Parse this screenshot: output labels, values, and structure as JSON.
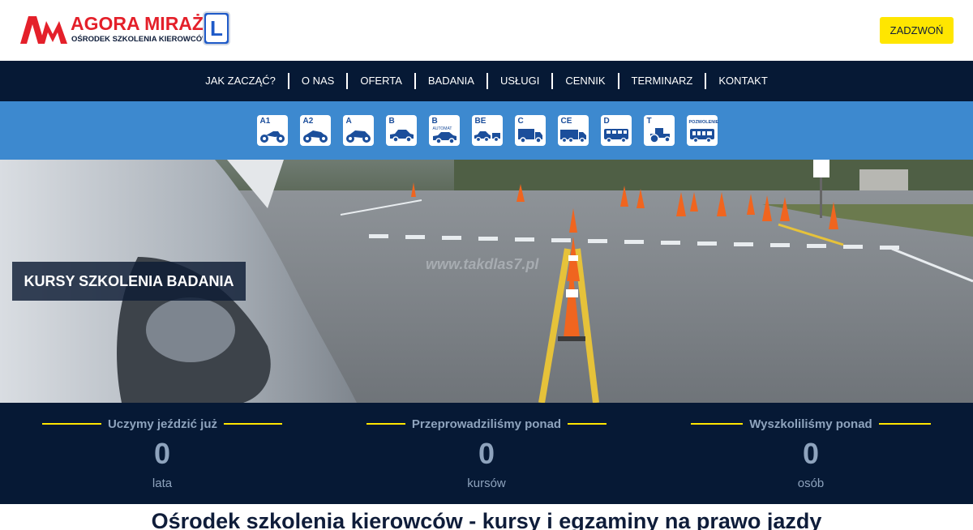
{
  "brand": {
    "title": "AGORA MIRAŻ",
    "subtitle": "OŚRODEK SZKOLENIA KIEROWCÓW",
    "badge_letter": "L",
    "accent_red": "#e4202a",
    "navy": "#061935",
    "blue": "#3d89cf",
    "yellow": "#ffe600"
  },
  "header": {
    "call_label": "ZADZWOŃ"
  },
  "nav": {
    "items": [
      {
        "label": "JAK ZACZĄĆ?"
      },
      {
        "label": "O NAS"
      },
      {
        "label": "OFERTA"
      },
      {
        "label": "BADANIA"
      },
      {
        "label": "USŁUGI"
      },
      {
        "label": "CENNIK"
      },
      {
        "label": "TERMINARZ"
      },
      {
        "label": "KONTAKT"
      }
    ]
  },
  "categories": [
    {
      "label": "A1",
      "icon": "scooter-icon"
    },
    {
      "label": "A2",
      "icon": "motorcycle-icon"
    },
    {
      "label": "A",
      "icon": "motorcycle-icon"
    },
    {
      "label": "B",
      "icon": "car-icon"
    },
    {
      "label": "B",
      "sub": "AUTOMAT",
      "icon": "car-icon"
    },
    {
      "label": "BE",
      "icon": "car-trailer-icon"
    },
    {
      "label": "C",
      "icon": "truck-icon"
    },
    {
      "label": "CE",
      "icon": "truck-trailer-icon"
    },
    {
      "label": "D",
      "icon": "bus-icon"
    },
    {
      "label": "T",
      "icon": "tractor-icon"
    },
    {
      "label": "POZWOLENIE",
      "icon": "tram-icon"
    }
  ],
  "hero": {
    "tagline": "KURSY SZKOLENIA BADANIA",
    "watermark": "www.takdlas7.pl"
  },
  "stats": [
    {
      "title": "Uczymy jeździć już",
      "value": "0",
      "unit": "lata"
    },
    {
      "title": "Przeprowadziliśmy ponad",
      "value": "0",
      "unit": "kursów"
    },
    {
      "title": "Wyszkoliliśmy ponad",
      "value": "0",
      "unit": "osób"
    }
  ],
  "main": {
    "heading": "Ośrodek szkolenia kierowców - kursy i egzaminy na prawo jazdy"
  }
}
